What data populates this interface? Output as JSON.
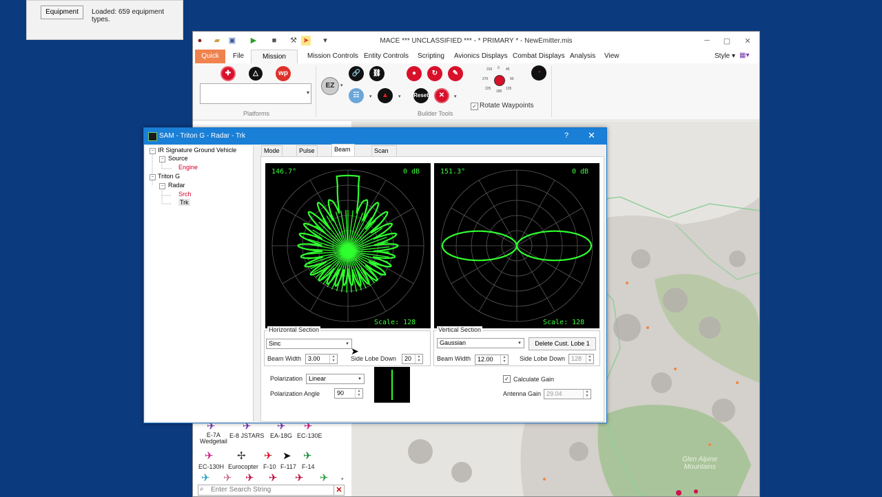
{
  "loaded_panel": {
    "button": "Equipment",
    "status": "Loaded: 659 equipment types."
  },
  "window": {
    "title": "MACE  *** UNCLASSIFIED ***  - * PRIMARY * - NewEmitter.mis"
  },
  "menu": {
    "quick": "Quick",
    "items": [
      "File",
      "Mission Builder",
      "Mission Controls",
      "Entity Controls",
      "Scripting",
      "Avionics Displays",
      "Combat Displays",
      "Analysis",
      "View"
    ],
    "style": "Style"
  },
  "ribbon": {
    "platforms_label": "Platforms",
    "builder_tools_label": "Builder Tools",
    "wp_icon": "wp",
    "ez_icon": "EZ",
    "reset_icon": "Reset",
    "rotate_waypoints": "Rotate Waypoints",
    "compass_labels": [
      "315",
      "0",
      "45",
      "270",
      "90",
      "225",
      "180",
      "135"
    ]
  },
  "map": {
    "label": "Glen Alpine\nMountains"
  },
  "palette": {
    "row1": [
      "E-7A\nWedgetail",
      "E-8 JSTARS",
      "EA-18G",
      "EC-130E"
    ],
    "row2": [
      "EC-130H",
      "Eurocopter",
      "F-10",
      "F-117",
      "F-14"
    ],
    "search_placeholder": "Enter Search String"
  },
  "dialog": {
    "title": "SAM - Triton G - Radar - Trk",
    "help": "?",
    "tree": {
      "root1": "IR Signature Ground Vehicle",
      "source": "Source",
      "engine": "Engine",
      "root2": "Triton G",
      "radar": "Radar",
      "srch": "Srch",
      "trk": "Trk"
    },
    "tabs": [
      "Mode Data",
      "Pulse Data",
      "Beam Shape",
      "Scan Pattern"
    ],
    "left_plot": {
      "angle": "146.7°",
      "db": "0 dB",
      "scale": "Scale: 128"
    },
    "right_plot": {
      "angle": "151.3°",
      "db": "0 dB",
      "scale": "Scale: 128"
    },
    "horizontal": {
      "title": "Horizontal Section",
      "type": "Sinc",
      "beam_width_label": "Beam Width",
      "beam_width": "3.00",
      "side_lobe_label": "Side Lobe Down",
      "side_lobe": "20"
    },
    "vertical": {
      "title": "Vertical Section",
      "type": "Gaussian",
      "delete_button": "Delete Cust. Lobe 1",
      "beam_width_label": "Beam Width",
      "beam_width": "12.00",
      "side_lobe_label": "Side Lobe Down",
      "side_lobe": "128"
    },
    "polarization_label": "Polarization",
    "polarization": "Linear",
    "polarization_angle_label": "Polarization Angle",
    "polarization_angle": "90",
    "calculate_gain_label": "Calculate Gain",
    "antenna_gain_label": "Antenna Gain",
    "antenna_gain": "29.04"
  }
}
